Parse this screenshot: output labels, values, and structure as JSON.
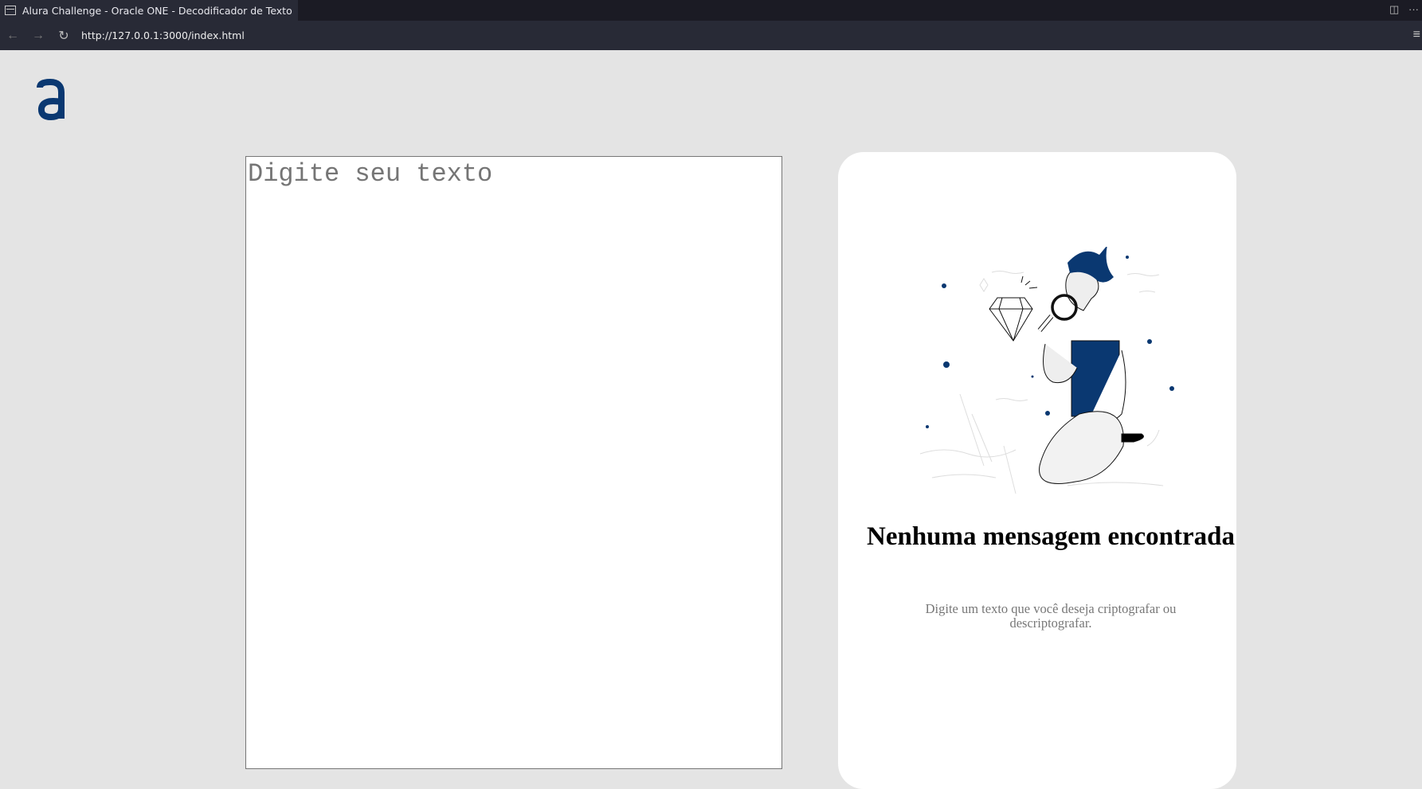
{
  "browser": {
    "tab_title": "Alura Challenge - Oracle ONE - Decodificador de Texto",
    "url": "http://127.0.0.1:3000/index.html"
  },
  "page": {
    "logo_text": "a",
    "input_placeholder": "Digite seu texto",
    "result": {
      "title": "Nenhuma mensagem encontrada",
      "description": "Digite um texto que você deseja criptografar ou descriptografar."
    }
  },
  "colors": {
    "brand": "#0a3871",
    "background": "#e4e4e4"
  }
}
